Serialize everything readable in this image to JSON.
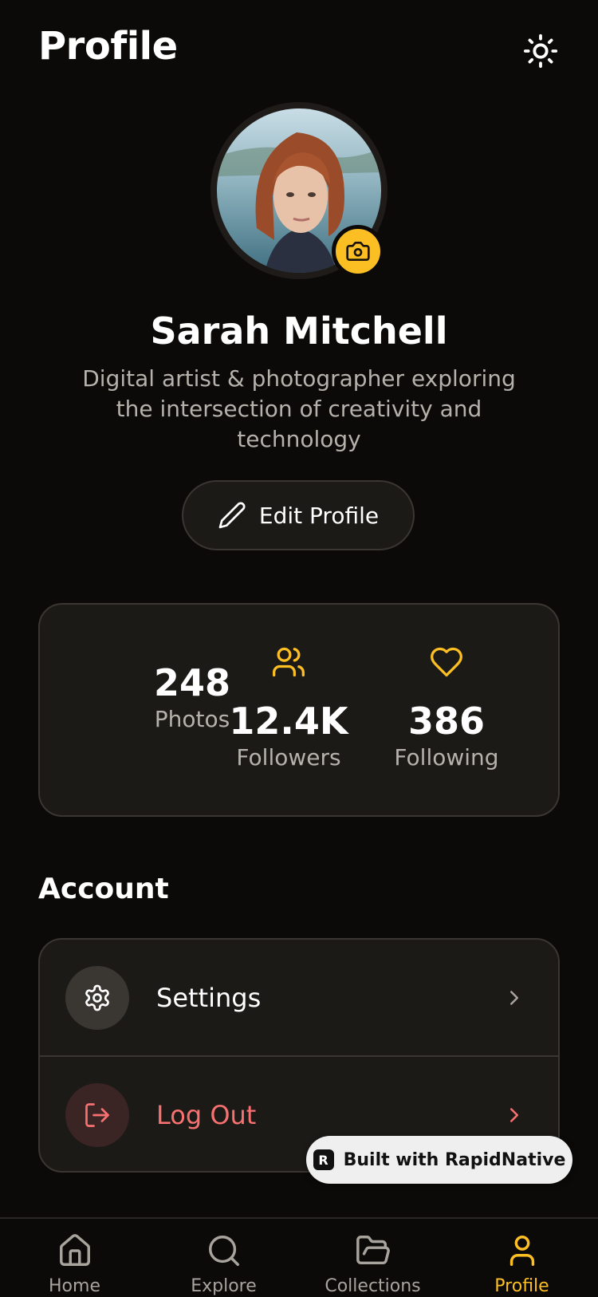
{
  "header": {
    "title": "Profile",
    "theme_icon": "sun-icon"
  },
  "profile": {
    "name": "Sarah Mitchell",
    "bio": "Digital artist & photographer exploring the intersection of creativity and technology",
    "edit_label": "Edit Profile"
  },
  "stats": [
    {
      "value": "248",
      "label": "Photos",
      "icon": ""
    },
    {
      "value": "12.4K",
      "label": "Followers",
      "icon": "users-icon"
    },
    {
      "value": "386",
      "label": "Following",
      "icon": "heart-icon"
    }
  ],
  "account": {
    "title": "Account",
    "items": [
      {
        "label": "Settings",
        "icon": "gear-icon"
      },
      {
        "label": "Log Out",
        "icon": "logout-icon"
      }
    ]
  },
  "badge": {
    "label": "Built with RapidNative",
    "logo": "R"
  },
  "tabs": [
    {
      "label": "Home",
      "icon": "home-icon"
    },
    {
      "label": "Explore",
      "icon": "search-icon"
    },
    {
      "label": "Collections",
      "icon": "folder-icon"
    },
    {
      "label": "Profile",
      "icon": "user-icon",
      "active": true
    }
  ],
  "colors": {
    "background": "#0b0a09",
    "card": "#1c1a17",
    "accent": "#fbbf24",
    "danger": "#f87171",
    "muted": "#b5b1ab"
  }
}
